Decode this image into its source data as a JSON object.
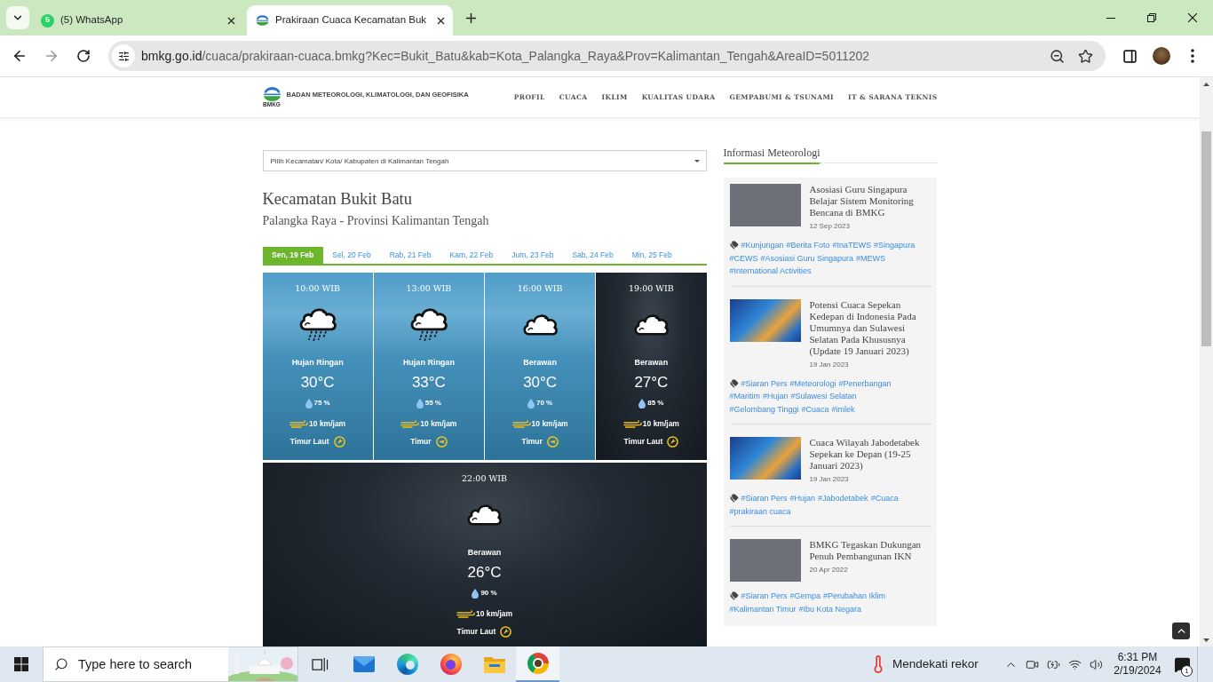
{
  "browser": {
    "tabs": [
      {
        "kind": "whatsapp",
        "badge": "5",
        "title": "(5) WhatsApp",
        "selected": false
      },
      {
        "kind": "bmkg",
        "title": "Prakiraan Cuaca Kecamatan Buk",
        "selected": true
      }
    ],
    "url": {
      "host": "bmkg.go.id",
      "path": "/cuaca/prakiraan-cuaca.bmkg?Kec=Bukit_Batu&kab=Kota_Palangka_Raya&Prov=Kalimantan_Tengah&AreaID=5011202"
    }
  },
  "header": {
    "logo_text": "BMKG",
    "org_name": "BADAN METEOROLOGI, KLIMATOLOGI, DAN GEOFISIKA",
    "nav": [
      "PROFIL",
      "CUACA",
      "IKLIM",
      "KUALITAS UDARA",
      "GEMPABUMI & TSUNAMI",
      "IT & SARANA TEKNIS"
    ]
  },
  "location_select": {
    "placeholder": "Pilih Kecamatan/ Kota/ Kabupaten di Kalimantan Tengah"
  },
  "title": "Kecamatan Bukit Batu",
  "subtitle": "Palangka Raya - Provinsi Kalimantan Tengah",
  "day_tabs": [
    {
      "label": "Sen, 19 Feb",
      "selected": true
    },
    {
      "label": "Sel, 20 Feb",
      "selected": false
    },
    {
      "label": "Rab, 21 Feb",
      "selected": false
    },
    {
      "label": "Kam, 22 Feb",
      "selected": false
    },
    {
      "label": "Jum, 23 Feb",
      "selected": false
    },
    {
      "label": "Sab, 24 Feb",
      "selected": false
    },
    {
      "label": "Min, 25 Feb",
      "selected": false
    }
  ],
  "forecasts": [
    {
      "kind": "day",
      "time": "10:00 WIB",
      "weather": {
        "kind": "rain",
        "condition": "Hujan Ringan"
      },
      "temperature": "30°C",
      "humidity": "75 %",
      "wind": {
        "kind": "ne",
        "speed": "10 km/jam",
        "direction": "Timur Laut"
      }
    },
    {
      "kind": "day",
      "time": "13:00 WIB",
      "weather": {
        "kind": "rain",
        "condition": "Hujan Ringan"
      },
      "temperature": "33°C",
      "humidity": "55 %",
      "wind": {
        "kind": "e",
        "speed": "10 km/jam",
        "direction": "Timur"
      }
    },
    {
      "kind": "day",
      "time": "16:00 WIB",
      "weather": {
        "kind": "cloud",
        "condition": "Berawan"
      },
      "temperature": "30°C",
      "humidity": "70 %",
      "wind": {
        "kind": "e",
        "speed": "10 km/jam",
        "direction": "Timur"
      }
    },
    {
      "kind": "night",
      "time": "19:00 WIB",
      "weather": {
        "kind": "cloud",
        "condition": "Berawan"
      },
      "temperature": "27°C",
      "humidity": "85 %",
      "wind": {
        "kind": "ne",
        "speed": "10 km/jam",
        "direction": "Timur Laut"
      }
    },
    {
      "kind": "night",
      "time": "22:00 WIB",
      "weather": {
        "kind": "cloud",
        "condition": "Berawan"
      },
      "temperature": "26°C",
      "humidity": "90 %",
      "wind": {
        "kind": "ne",
        "speed": "10 km/jam",
        "direction": "Timur Laut"
      }
    }
  ],
  "sidebar": {
    "title": "Informasi Meteorologi",
    "news": [
      {
        "kind": "photo",
        "title": "Asosiasi Guru Singapura Belajar Sistem Monitoring Bencana di BMKG",
        "date": "12 Sep 2023",
        "tags": [
          "#Kunjungan",
          "#Berita Foto",
          "#InaTEWS",
          "#Singapura",
          "#CEWS",
          "#Asosiasi Guru Singapura",
          "#MEWS",
          "#International Activities"
        ]
      },
      {
        "kind": "map",
        "title": "Potensi Cuaca Sepekan Kedepan di Indonesia Pada Umumnya dan Sulawesi Selatan Pada Khususnya (Update 19 Januari 2023)",
        "date": "19 Jan 2023",
        "tags": [
          "#Siaran Pers",
          "#Meteorologi",
          "#Penerbangan",
          "#Maritim",
          "#Hujan",
          "#Sulawesi Selatan",
          "#Gelombang Tinggi",
          "#Cuaca",
          "#imlek"
        ]
      },
      {
        "kind": "map",
        "title": "Cuaca Wilayah Jabodetabek Sepekan ke Depan (19-25 Januari 2023)",
        "date": "19 Jan 2023",
        "tags": [
          "#Siaran Pers",
          "#Hujan",
          "#Jabodetabek",
          "#Cuaca",
          "#prakiraan cuaca"
        ]
      },
      {
        "kind": "photo",
        "title": "BMKG Tegaskan Dukungan Penuh Pembangunan IKN",
        "date": "20 Apr 2022",
        "tags": [
          "#Siaran Pers",
          "#Gempa",
          "#Perubahan Iklim",
          "#Kalimantan Timur",
          "#Ibu Kota Negara"
        ]
      }
    ]
  },
  "taskbar": {
    "search": {
      "placeholder": "Type here to search"
    },
    "apps": [
      {
        "kind": "task_view",
        "selected": false
      },
      {
        "kind": "mail",
        "selected": false
      },
      {
        "kind": "edge",
        "selected": false
      },
      {
        "kind": "firefox",
        "selected": false
      },
      {
        "kind": "explorer",
        "selected": false
      },
      {
        "kind": "chrome",
        "selected": true
      }
    ],
    "weather": "Mendekati rekor",
    "time": "6:31 PM",
    "date": "2/19/2024",
    "notifications": "1"
  }
}
